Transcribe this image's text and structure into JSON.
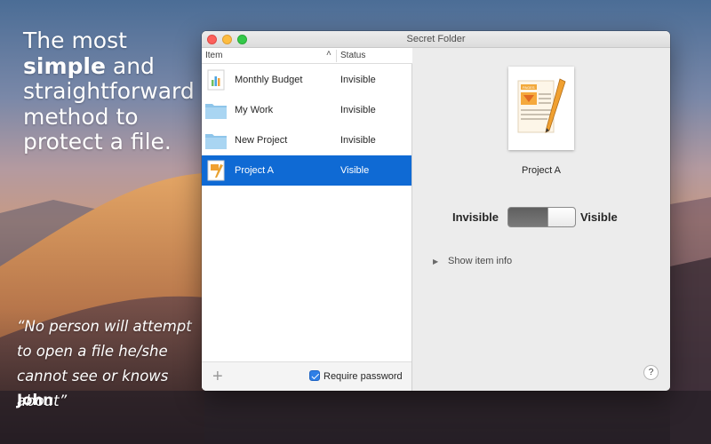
{
  "promo": {
    "headline_line1": "The most",
    "headline_bold": "simple",
    "headline_rest": " and",
    "headline_line3": "straightforward",
    "headline_line4": "method to",
    "headline_line5": "protect a file.",
    "quote": "“No person will attempt to open a file he/she cannot see or knows about”",
    "author": "John"
  },
  "window": {
    "title": "Secret Folder"
  },
  "list": {
    "col_item": "Item",
    "col_status": "Status",
    "sort_icon": "chevron-up-icon",
    "rows": [
      {
        "name": "Monthly Budget",
        "status": "Invisible",
        "icon": "numbers-file-icon"
      },
      {
        "name": "My Work",
        "status": "Invisible",
        "icon": "folder-icon"
      },
      {
        "name": "New Project",
        "status": "Invisible",
        "icon": "folder-icon"
      },
      {
        "name": "Project A",
        "status": "Visible",
        "icon": "pages-file-icon",
        "selected": true
      }
    ],
    "add_label": "+",
    "require_password_label": "Require password",
    "require_password_checked": true
  },
  "detail": {
    "doc_name": "Project A",
    "invisible_label": "Invisible",
    "visible_label": "Visible",
    "switch_state": "visible",
    "show_info_label": "Show item info",
    "help_label": "?"
  },
  "colors": {
    "selection": "#0f6ad4",
    "checkbox": "#2f7fe6",
    "pages_orange": "#f0a030"
  }
}
